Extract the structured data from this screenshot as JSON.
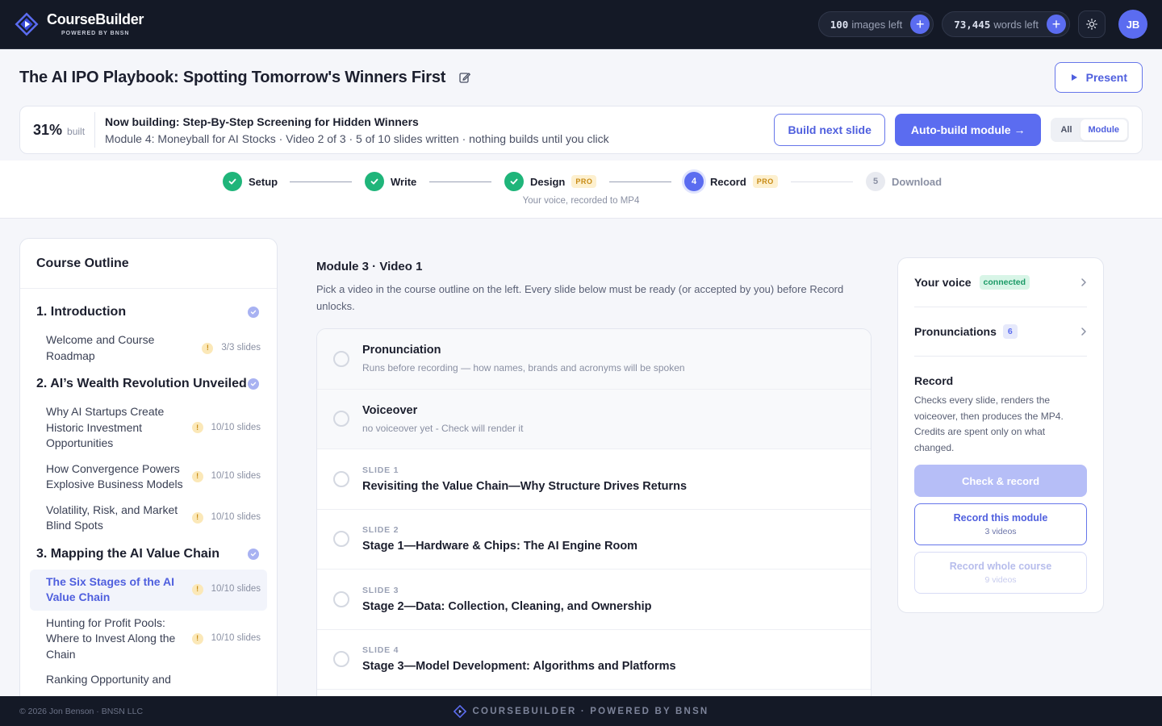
{
  "app": {
    "name": "CourseBuilder",
    "tagline": "POWERED BY BNSN"
  },
  "header": {
    "images_count": "100",
    "images_label": "images left",
    "words_count": "73,445",
    "words_label": "words left",
    "avatar_initials": "JB"
  },
  "course": {
    "title": "The AI IPO Playbook: Spotting Tomorrow's Winners First",
    "present_label": "Present"
  },
  "build": {
    "percent": "31%",
    "percent_label": "built",
    "title": "Now building: Step-By-Step Screening for Hidden Winners",
    "subtitle": "Module 4: Moneyball for AI Stocks · Video 2 of 3 · 5 of 10 slides written · nothing builds until you click",
    "next_label": "Build next slide",
    "auto_label": "Auto-build module →",
    "scope_options": [
      "All",
      "Module"
    ],
    "scope_selected": "Module"
  },
  "steps": [
    {
      "label": "Setup",
      "state": "done"
    },
    {
      "label": "Write",
      "state": "done"
    },
    {
      "label": "Design",
      "state": "done",
      "pro": "PRO"
    },
    {
      "label": "Record",
      "state": "active",
      "number": "4",
      "pro": "PRO"
    },
    {
      "label": "Download",
      "state": "todo",
      "number": "5"
    }
  ],
  "step_caption": "Your voice, recorded to MP4",
  "outline": {
    "title": "Course Outline",
    "modules": [
      {
        "title": "1. Introduction",
        "videos": [
          {
            "title": "Welcome and Course Roadmap",
            "count": "3/3 slides"
          }
        ]
      },
      {
        "title": "2. AI’s Wealth Revolution Unveiled",
        "videos": [
          {
            "title": "Why AI Startups Create Historic Investment Opportunities",
            "count": "10/10 slides"
          },
          {
            "title": "How Convergence Powers Explosive Business Models",
            "count": "10/10 slides"
          },
          {
            "title": "Volatility, Risk, and Market Blind Spots",
            "count": "10/10 slides"
          }
        ]
      },
      {
        "title": "3. Mapping the AI Value Chain",
        "videos": [
          {
            "title": "The Six Stages of the AI Value Chain",
            "count": "10/10 slides",
            "selected": true
          },
          {
            "title": "Hunting for Profit Pools: Where to Invest Along the Chain",
            "count": "10/10 slides"
          },
          {
            "title": "Ranking Opportunity and",
            "count": ""
          }
        ]
      }
    ]
  },
  "main": {
    "title": "Module 3 · Video 1",
    "description": "Pick a video in the course outline on the left. Every slide below must be ready (or accepted by you) before Record unlocks.",
    "items": [
      {
        "title": "Pronunciation",
        "sub": "Runs before recording — how names, brands and acronyms will be spoken"
      },
      {
        "title": "Voiceover",
        "sub": "no voiceover yet - Check will render it"
      },
      {
        "kicker": "SLIDE 1",
        "title": "Revisiting the Value Chain—Why Structure Drives Returns"
      },
      {
        "kicker": "SLIDE 2",
        "title": "Stage 1—Hardware & Chips: The AI Engine Room"
      },
      {
        "kicker": "SLIDE 3",
        "title": "Stage 2—Data: Collection, Cleaning, and Ownership"
      },
      {
        "kicker": "SLIDE 4",
        "title": "Stage 3—Model Development: Algorithms and Platforms"
      }
    ]
  },
  "panel": {
    "voice_label": "Your voice",
    "voice_status": "connected",
    "pron_label": "Pronunciations",
    "pron_count": "6",
    "record_title": "Record",
    "record_desc": "Checks every slide, renders the voiceover, then produces the MP4. Credits are spent only on what changed.",
    "check_label": "Check & record",
    "module_label": "Record this module",
    "module_sub": "3 videos",
    "course_label": "Record whole course",
    "course_sub": "9 videos"
  },
  "footer": {
    "copyright": "© 2026 Jon Benson · BNSN LLC",
    "center": "COURSEBUILDER · POWERED BY BNSN"
  },
  "icons": [
    "logo-icon",
    "plus-icon",
    "sun-icon",
    "edit-icon",
    "play-icon",
    "check-icon",
    "warning-icon",
    "chevron-right-icon"
  ],
  "colors": {
    "accent": "#5b6cf0",
    "success": "#1fb57a",
    "warning": "#c78a13",
    "dark": "#141926"
  }
}
